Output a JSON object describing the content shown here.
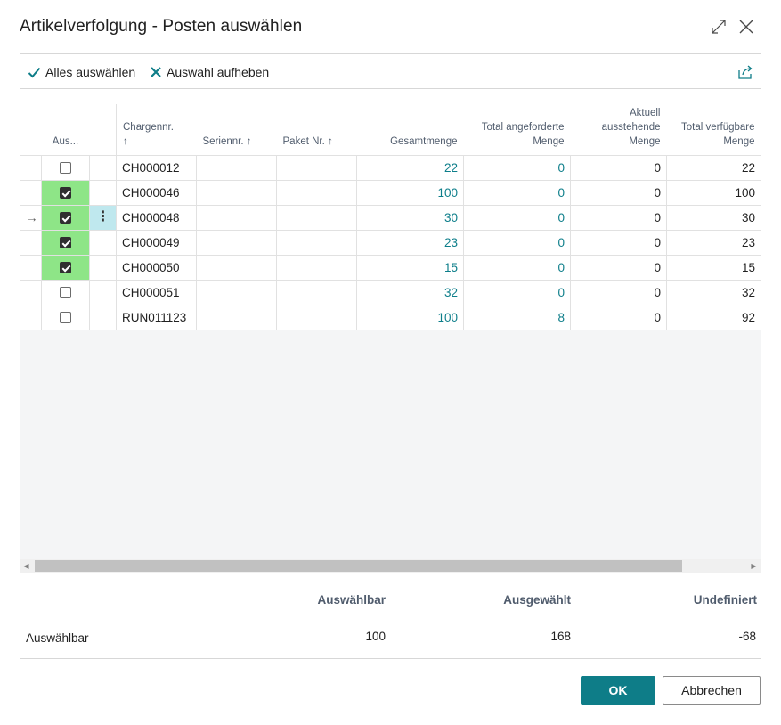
{
  "dialog": {
    "title": "Artikelverfolgung - Posten auswählen"
  },
  "actions": {
    "select_all": "Alles auswählen",
    "deselect": "Auswahl aufheben"
  },
  "columns": {
    "select": "Aus...",
    "lot": [
      "Chargennr.",
      "↑"
    ],
    "serial": "Seriennr. ↑",
    "package": "Paket Nr. ↑",
    "total_qty": "Gesamtmenge",
    "total_requested": [
      "Total angeforderte",
      "Menge"
    ],
    "current_pending": [
      "Aktuell",
      "ausstehende",
      "Menge"
    ],
    "total_available": [
      "Total verfügbare",
      "Menge"
    ]
  },
  "rows": [
    {
      "selected": false,
      "current": false,
      "lot": "CH000012",
      "serial": "",
      "package": "",
      "total_qty": "22",
      "requested": "0",
      "pending": "0",
      "available": "22"
    },
    {
      "selected": true,
      "current": false,
      "lot": "CH000046",
      "serial": "",
      "package": "",
      "total_qty": "100",
      "requested": "0",
      "pending": "0",
      "available": "100"
    },
    {
      "selected": true,
      "current": true,
      "lot": "CH000048",
      "serial": "",
      "package": "",
      "total_qty": "30",
      "requested": "0",
      "pending": "0",
      "available": "30"
    },
    {
      "selected": true,
      "current": false,
      "lot": "CH000049",
      "serial": "",
      "package": "",
      "total_qty": "23",
      "requested": "0",
      "pending": "0",
      "available": "23"
    },
    {
      "selected": true,
      "current": false,
      "lot": "CH000050",
      "serial": "",
      "package": "",
      "total_qty": "15",
      "requested": "0",
      "pending": "0",
      "available": "15"
    },
    {
      "selected": false,
      "current": false,
      "lot": "CH000051",
      "serial": "",
      "package": "",
      "total_qty": "32",
      "requested": "0",
      "pending": "0",
      "available": "32"
    },
    {
      "selected": false,
      "current": false,
      "lot": "RUN011123",
      "serial": "",
      "package": "",
      "total_qty": "100",
      "requested": "8",
      "pending": "0",
      "available": "92"
    }
  ],
  "summary": {
    "headers": {
      "selectable": "Auswählbar",
      "selected": "Ausgewählt",
      "undefined": "Undefiniert"
    },
    "row_label": "Auswählbar",
    "values": {
      "selectable": "100",
      "selected": "168",
      "undefined": "-68"
    }
  },
  "buttons": {
    "ok": "OK",
    "cancel": "Abbrechen"
  },
  "colors": {
    "accent": "#0e7d88",
    "link": "#0d7e8a",
    "selected_cell": "#8ee587",
    "active_row": "#bfe8ee"
  }
}
